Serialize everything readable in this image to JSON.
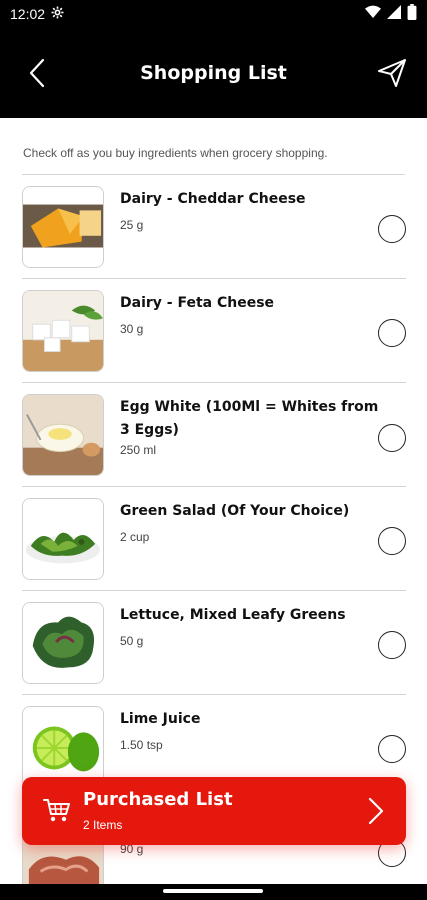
{
  "status_bar": {
    "time": "12:02"
  },
  "app_bar": {
    "title": "Shopping List"
  },
  "hint": "Check off as you buy ingredients when grocery shopping.",
  "items": [
    {
      "name": "Dairy - Cheddar Cheese",
      "qty": "25 g",
      "image": "cheddar-cheese"
    },
    {
      "name": "Dairy - Feta Cheese",
      "qty": "30 g",
      "image": "feta-cheese"
    },
    {
      "name": "Egg White (100Ml = Whites from 3 Eggs)",
      "qty": "250 ml",
      "image": "egg-white"
    },
    {
      "name": "Green Salad (Of Your Choice)",
      "qty": "2 cup",
      "image": "green-salad"
    },
    {
      "name": "Lettuce, Mixed Leafy Greens",
      "qty": "50 g",
      "image": "lettuce"
    },
    {
      "name": "Lime Juice",
      "qty": "1.50 tsp",
      "image": "lime"
    },
    {
      "name": "",
      "qty": "90 g",
      "image": "meat"
    }
  ],
  "purchased": {
    "title": "Purchased List",
    "count": "2 Items"
  },
  "colors": {
    "accent": "#e5180e",
    "header": "#000000"
  }
}
